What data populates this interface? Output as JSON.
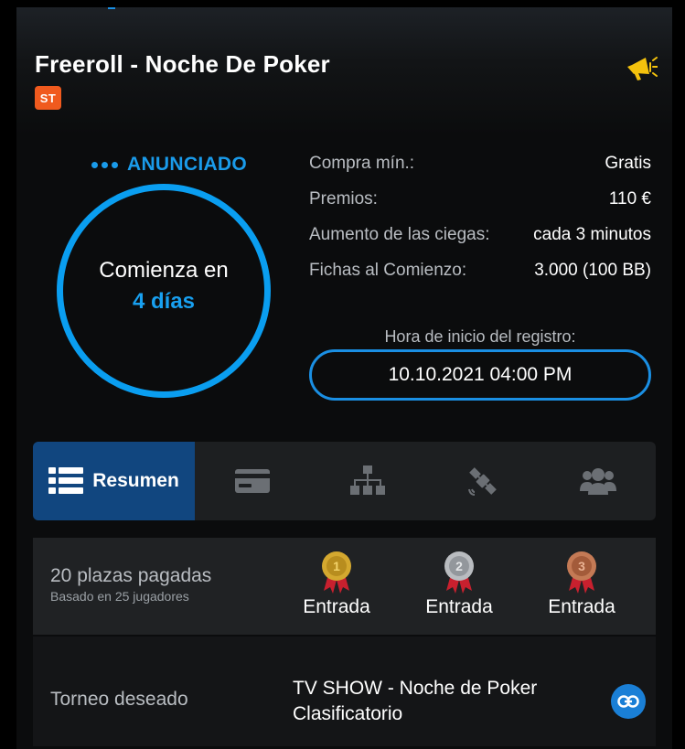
{
  "header": {
    "title": "Freeroll - Noche De Poker",
    "badge": "ST",
    "announce_icon": "megaphone-icon"
  },
  "status": {
    "label": "ANUNCIADO"
  },
  "countdown": {
    "line1": "Comienza en",
    "line2": "4 días"
  },
  "info": [
    {
      "label": "Compra mín.:",
      "value": "Gratis"
    },
    {
      "label": "Premios:",
      "value": "110 €"
    },
    {
      "label": "Aumento de las ciegas:",
      "value": "cada 3 minutos"
    },
    {
      "label": "Fichas al Comienzo:",
      "value": "3.000 (100 BB)"
    }
  ],
  "registration": {
    "label": "Hora de inicio del registro:",
    "value": "10.10.2021 04:00 PM"
  },
  "tabs": [
    {
      "label": "Resumen",
      "icon": "list-icon",
      "active": true
    },
    {
      "label": "",
      "icon": "card-icon",
      "active": false
    },
    {
      "label": "",
      "icon": "bracket-icon",
      "active": false
    },
    {
      "label": "",
      "icon": "satellite-icon",
      "active": false
    },
    {
      "label": "",
      "icon": "players-icon",
      "active": false
    }
  ],
  "summary": {
    "places": "20 plazas pagadas",
    "based_on": "Basado en 25 jugadores",
    "prizes": [
      {
        "rank": "1",
        "label": "Entrada",
        "color": "#d4a82f"
      },
      {
        "rank": "2",
        "label": "Entrada",
        "color": "#b9bcc0"
      },
      {
        "rank": "3",
        "label": "Entrada",
        "color": "#c47a55"
      }
    ]
  },
  "target": {
    "label": "Torneo deseado",
    "line1": "TV SHOW - Noche de Poker",
    "line2": "Clasificatorio"
  },
  "colors": {
    "accent": "#0a9ef0",
    "active_tab": "#11467f",
    "badge": "#f05a1e",
    "megaphone": "#f4c20d"
  }
}
